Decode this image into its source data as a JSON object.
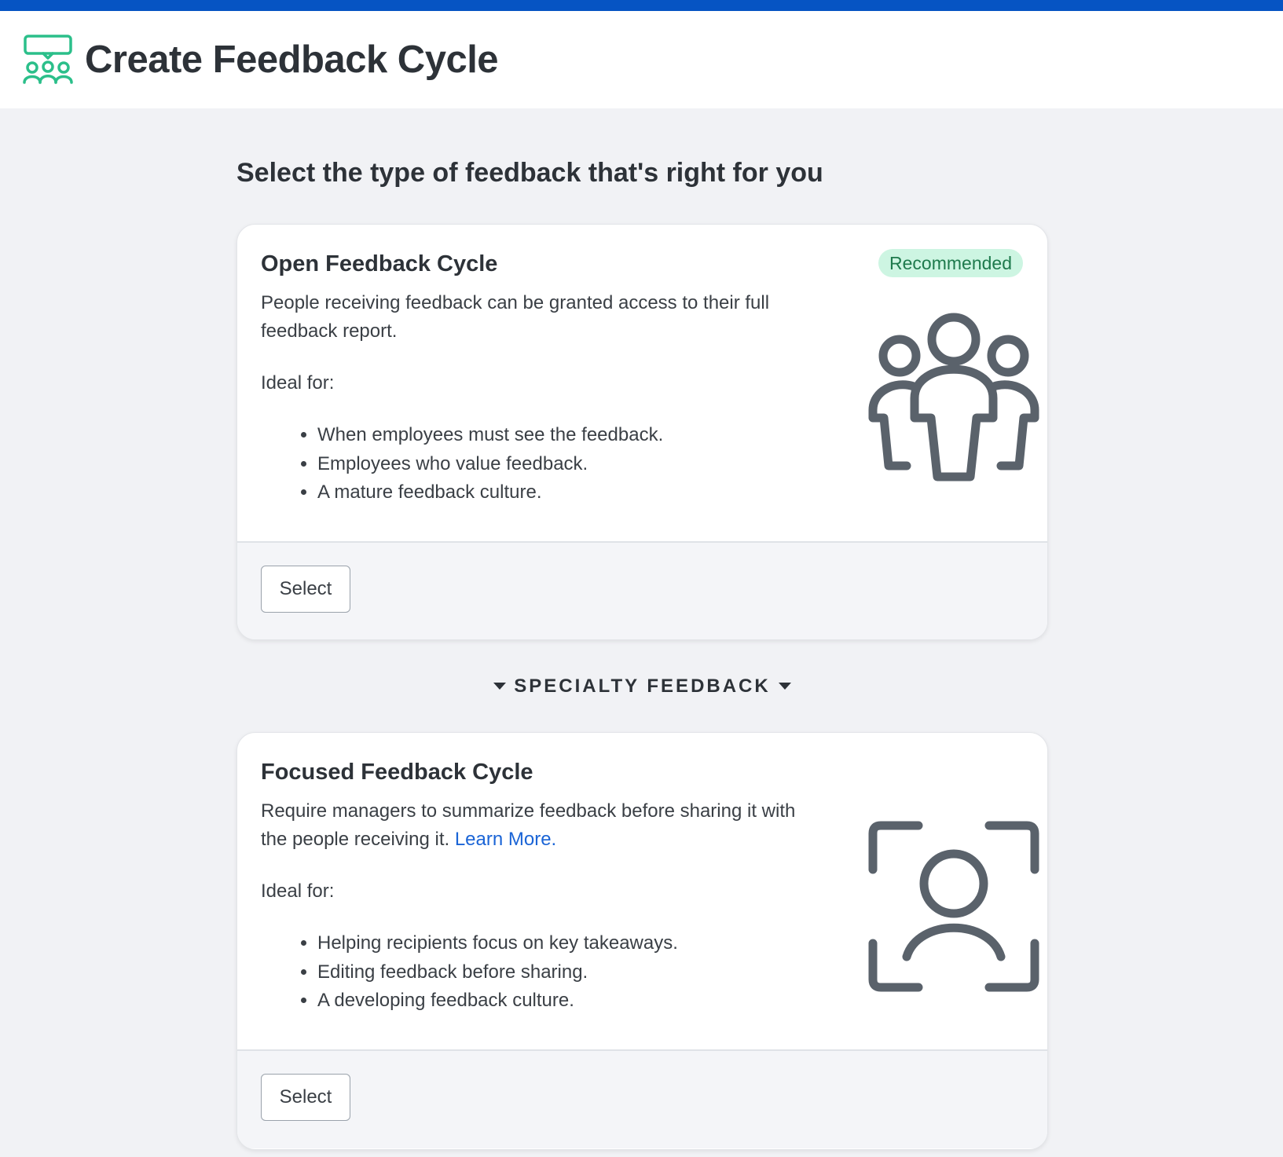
{
  "header": {
    "title": "Create Feedback Cycle",
    "icon": "feedback-cycle-icon",
    "accent_color": "#2bbf8a",
    "topbar_color": "#0654c3"
  },
  "main": {
    "heading": "Select the type of feedback that's right for you"
  },
  "open_card": {
    "title": "Open Feedback Cycle",
    "badge": "Recommended",
    "description": "People receiving feedback can be granted access to their full feedback report.",
    "ideal_for_label": "Ideal for:",
    "bullets": [
      "When employees must see the feedback.",
      "Employees who value feedback.",
      "A mature feedback culture."
    ],
    "illustration_icon": "group-people-icon",
    "select_label": "Select"
  },
  "specialty": {
    "label": "SPECIALTY FEEDBACK"
  },
  "focused_card": {
    "title": "Focused Feedback Cycle",
    "description": "Require managers to summarize feedback before sharing it with the people receiving it.",
    "learn_more": "Learn More.",
    "ideal_for_label": "Ideal for:",
    "bullets": [
      "Helping recipients focus on key takeaways.",
      "Editing feedback before sharing.",
      "A developing feedback culture."
    ],
    "illustration_icon": "focus-person-icon",
    "select_label": "Select"
  }
}
